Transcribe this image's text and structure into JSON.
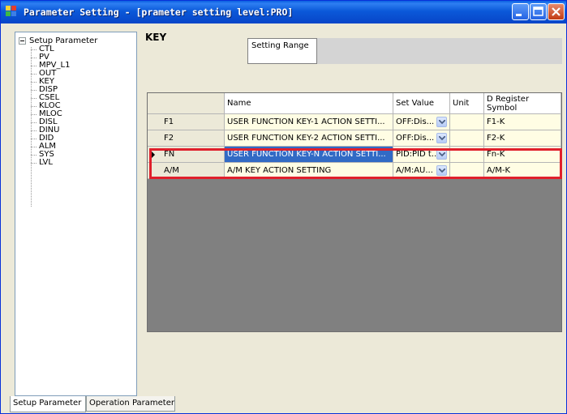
{
  "window": {
    "title": "Parameter Setting - [prameter setting level:PRO]"
  },
  "tree": {
    "root": "Setup Parameter",
    "items": [
      "CTL",
      "PV",
      "MPV_L1",
      "OUT",
      "KEY",
      "DISP",
      "CSEL",
      "KLOC",
      "MLOC",
      "DISL",
      "DINU",
      "DID",
      "ALM",
      "SYS",
      "LVL"
    ]
  },
  "main": {
    "title": "KEY",
    "setting_range_label": "Setting Range",
    "setting_range_value": ""
  },
  "table": {
    "headers": {
      "row": "",
      "name": "Name",
      "set_value": "Set Value",
      "unit": "Unit",
      "dreg_line1": "D Register",
      "dreg_line2": "Symbol"
    },
    "rows": [
      {
        "label": "F1",
        "name": "USER FUNCTION KEY-1 ACTION SETTI...",
        "set_value": "OFF:Dis...",
        "unit": "",
        "dreg": "F1-K"
      },
      {
        "label": "F2",
        "name": "USER FUNCTION KEY-2 ACTION SETTI...",
        "set_value": "OFF:Dis...",
        "unit": "",
        "dreg": "F2-K"
      },
      {
        "label": "FN",
        "name": "USER FUNCTION KEY-N ACTION SETTI...",
        "set_value": "PID:PID t...",
        "unit": "",
        "dreg": "Fn-K"
      },
      {
        "label": "A/M",
        "name": "A/M KEY ACTION SETTING",
        "set_value": "A/M:AU...",
        "unit": "",
        "dreg": "A/M-K"
      }
    ]
  },
  "tabs": [
    "Setup Parameter",
    "Operation Parameter"
  ],
  "colors": {
    "title_bar": "#0a5fe0",
    "highlight_border": "#e0202c",
    "selection": "#316ac5",
    "row_background": "#fffde4",
    "grid_background": "#808080"
  },
  "icons": {
    "app": "app-grid-icon",
    "minimize": "minimize-icon",
    "maximize": "maximize-icon",
    "close": "close-icon",
    "tree_expander": "tree-collapse-icon",
    "combo": "chevron-down-icon",
    "row_pointer": "current-row-icon"
  }
}
